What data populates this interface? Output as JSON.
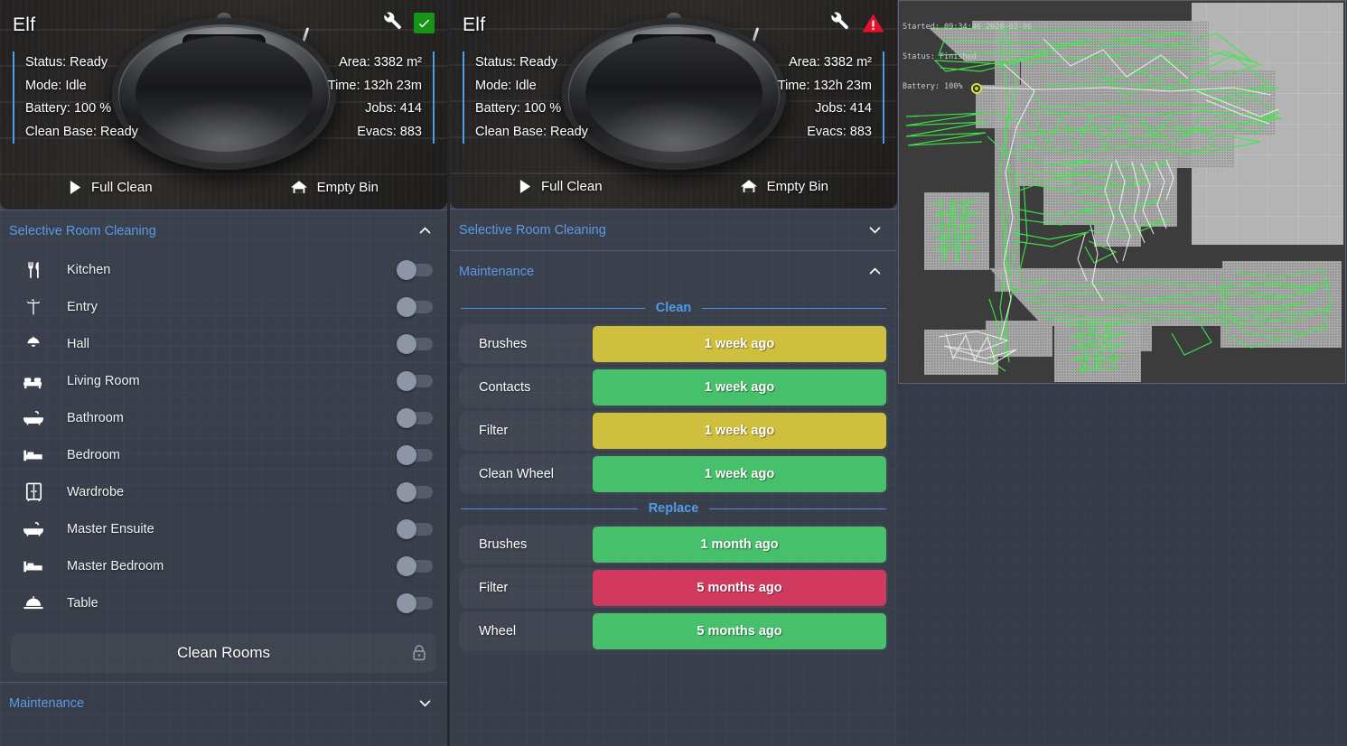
{
  "panels": [
    {
      "id": "left",
      "title": "Elf",
      "header_icons": {
        "wrench": "wrench-icon",
        "status": "check-ok-icon"
      },
      "stats_left": [
        "Status: Ready",
        "Mode: Idle",
        "Battery: 100 %",
        "Clean Base: Ready"
      ],
      "stats_right": [
        "Area: 3382 m²",
        "Time: 132h 23m",
        "Jobs: 414",
        "Evacs: 883"
      ],
      "actions": [
        {
          "label": "Full Clean",
          "icon": "play-icon"
        },
        {
          "label": "Empty Bin",
          "icon": "empty-bin-icon"
        }
      ],
      "sections": {
        "rooms": {
          "title": "Selective Room Cleaning",
          "expanded": true,
          "chevron": "chevron-up-icon"
        },
        "maintenance": {
          "title": "Maintenance",
          "expanded": false,
          "chevron": "chevron-down-icon"
        }
      },
      "rooms": [
        {
          "label": "Kitchen",
          "icon": "cutlery-icon",
          "on": false
        },
        {
          "label": "Entry",
          "icon": "coat-rack-icon",
          "on": false
        },
        {
          "label": "Hall",
          "icon": "ceiling-lamp-icon",
          "on": false
        },
        {
          "label": "Living Room",
          "icon": "sofa-icon",
          "on": false
        },
        {
          "label": "Bathroom",
          "icon": "bathtub-icon",
          "on": false
        },
        {
          "label": "Bedroom",
          "icon": "bed-icon",
          "on": false
        },
        {
          "label": "Wardrobe",
          "icon": "wardrobe-icon",
          "on": false
        },
        {
          "label": "Master Ensuite",
          "icon": "bathtub-icon",
          "on": false
        },
        {
          "label": "Master Bedroom",
          "icon": "bed-icon",
          "on": false
        },
        {
          "label": "Table",
          "icon": "cloche-icon",
          "on": false
        }
      ],
      "clean_rooms_button": {
        "label": "Clean Rooms",
        "icon": "lock-icon"
      }
    },
    {
      "id": "middle",
      "title": "Elf",
      "header_icons": {
        "wrench": "wrench-icon",
        "status": "warning-triangle-icon"
      },
      "stats_left": [
        "Status: Ready",
        "Mode: Idle",
        "Battery: 100 %",
        "Clean Base: Ready"
      ],
      "stats_right": [
        "Area: 3382 m²",
        "Time: 132h 23m",
        "Jobs: 414",
        "Evacs: 883"
      ],
      "actions": [
        {
          "label": "Full Clean",
          "icon": "play-icon"
        },
        {
          "label": "Empty Bin",
          "icon": "empty-bin-icon"
        }
      ],
      "sections": {
        "rooms": {
          "title": "Selective Room Cleaning",
          "expanded": false,
          "chevron": "chevron-down-icon"
        },
        "maintenance": {
          "title": "Maintenance",
          "expanded": true,
          "chevron": "chevron-up-icon"
        }
      },
      "maintenance": {
        "groups": [
          {
            "title": "Clean",
            "rows": [
              {
                "name": "Brushes",
                "value": "1 week ago",
                "state": "yellow"
              },
              {
                "name": "Contacts",
                "value": "1 week ago",
                "state": "green"
              },
              {
                "name": "Filter",
                "value": "1 week ago",
                "state": "yellow"
              },
              {
                "name": "Clean Wheel",
                "value": "1 week ago",
                "state": "green"
              }
            ]
          },
          {
            "title": "Replace",
            "rows": [
              {
                "name": "Brushes",
                "value": "1 month ago",
                "state": "green"
              },
              {
                "name": "Filter",
                "value": "5 months ago",
                "state": "red"
              },
              {
                "name": "Wheel",
                "value": "5 months ago",
                "state": "green"
              }
            ]
          }
        ]
      }
    }
  ],
  "map": {
    "overlay_lines": [
      "Started: 09:34:46 2020-02-06",
      "Status: Finished",
      "Battery: 100%"
    ],
    "path_color": "#3dea4a",
    "path_color_secondary": "#eef4ee",
    "floor_color": "#a9a9a9",
    "wall_color": "#3c3c3c",
    "dock_marker_color": "#cbd22a"
  },
  "colors": {
    "accent_blue": "#4d9de8",
    "green": "#46c06a",
    "yellow": "#cfbf3e",
    "red": "#d13a5e",
    "panel_bg": "#373d49"
  }
}
